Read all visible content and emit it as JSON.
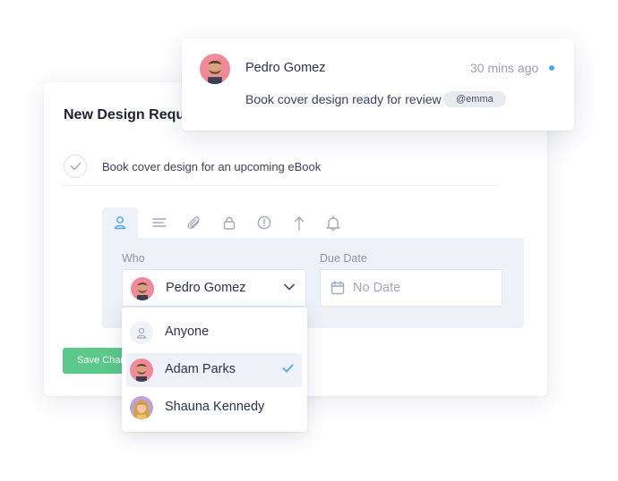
{
  "task_card": {
    "title": "New Design Request",
    "task_text": "Book cover design for an upcoming eBook",
    "toolbar": {
      "icons": [
        "person-icon",
        "description-lines-icon",
        "paperclip-icon",
        "lock-icon",
        "alert-circle-icon",
        "upload-arrow-icon",
        "bell-icon"
      ],
      "active": "person-icon"
    },
    "who_label": "Who",
    "who_selected": "Pedro Gomez",
    "due_date_label": "Due Date",
    "due_date_placeholder": "No Date",
    "save_button": "Save Changes"
  },
  "assignee_dropdown": {
    "options": [
      {
        "label": "Anyone",
        "icon": "person-icon",
        "selected": false
      },
      {
        "label": "Adam Parks",
        "icon": "avatar",
        "selected": true
      },
      {
        "label": "Shauna Kennedy",
        "icon": "avatar",
        "selected": false
      }
    ]
  },
  "notification": {
    "sender": "Pedro Gomez",
    "time": "30 mins ago",
    "message": "Book cover design ready for review",
    "mention": "@emma",
    "unread": true
  },
  "colors": {
    "accent_blue": "#4aa8ee",
    "save_green": "#5bc98a",
    "panel_bg": "#eef1f7",
    "text_dark": "#2d3250",
    "text_muted": "#8f93a8"
  }
}
